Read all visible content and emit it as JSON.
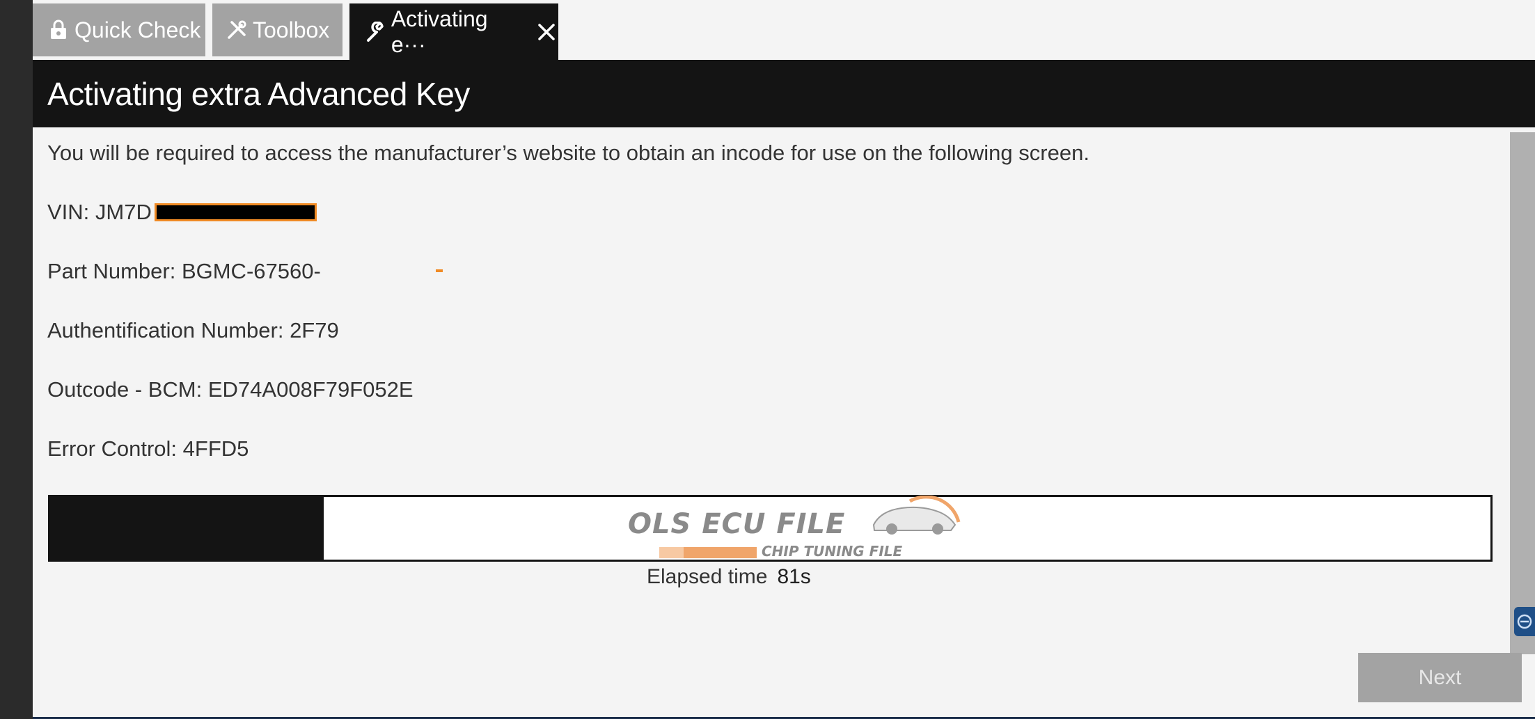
{
  "tabs": [
    {
      "label": "Quick Check",
      "icon": "lock-icon",
      "state": "inactive"
    },
    {
      "label": "Toolbox",
      "icon": "tools-icon",
      "state": "inactive"
    },
    {
      "label": "Activating e···",
      "icon": "wrench-icon",
      "state": "active"
    }
  ],
  "page": {
    "title": "Activating extra Advanced Key",
    "intro": "You will be required to access the manufacturer’s website to obtain an incode for use on the following screen."
  },
  "fields": {
    "vin": "VIN: JM7D",
    "part_number": "Part Number: BGMC-67560-",
    "authentification_number": "Authentification Number: 2F79",
    "outcode_bcm": "Outcode - BCM: ED74A008F79F052E",
    "error_control": "Error Control: 4FFD5"
  },
  "progress": {
    "fraction": 0.19,
    "elapsed_label": "Elapsed time",
    "elapsed_value": "81s"
  },
  "watermark": {
    "title": "OLS ECU FILE",
    "subtitle": "CHIP TUNING FILE"
  },
  "buttons": {
    "next_label": "Next"
  },
  "colors": {
    "header_bg": "#141414",
    "tab_inactive": "#a3a3a3",
    "redaction_border": "#f08a24",
    "button_disabled": "#a3a3a3"
  }
}
